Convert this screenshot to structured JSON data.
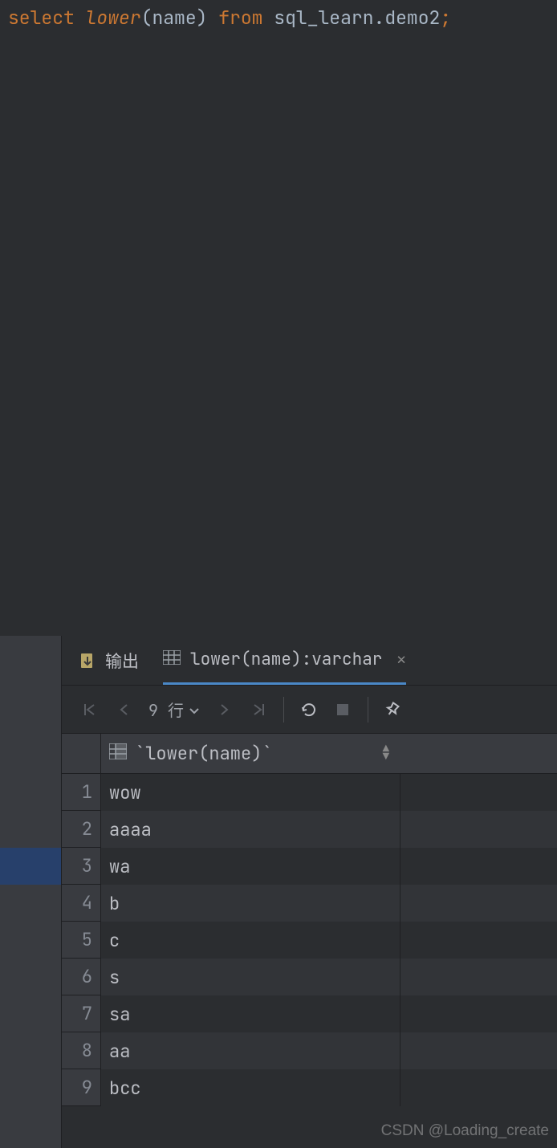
{
  "editor": {
    "tokens": {
      "select": "select",
      "lower": "lower",
      "paren_open": "(",
      "name": "name",
      "paren_close": ")",
      "from": "from",
      "schema": "sql_learn",
      "dot": ".",
      "table": "demo2",
      "semi": ";"
    }
  },
  "tabs": {
    "output_label": "输出",
    "result_label": "lower(name):varchar"
  },
  "toolbar": {
    "row_count_label": "9 行"
  },
  "table": {
    "header": "`lower(name)`",
    "rows": [
      {
        "n": "1",
        "v": "wow"
      },
      {
        "n": "2",
        "v": "aaaa"
      },
      {
        "n": "3",
        "v": "wa"
      },
      {
        "n": "4",
        "v": "b"
      },
      {
        "n": "5",
        "v": "c"
      },
      {
        "n": "6",
        "v": "s"
      },
      {
        "n": "7",
        "v": "sa"
      },
      {
        "n": "8",
        "v": "aa"
      },
      {
        "n": "9",
        "v": "bcc"
      }
    ]
  },
  "watermark": "CSDN @Loading_create"
}
